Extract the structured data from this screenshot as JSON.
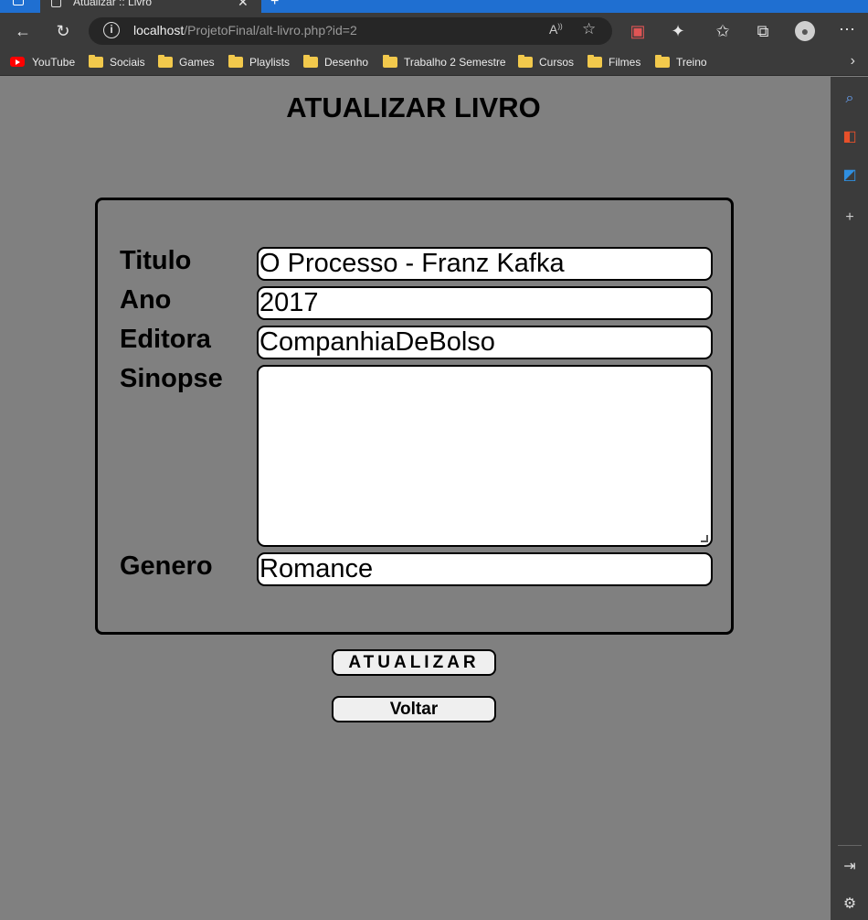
{
  "browser": {
    "tab_title": "Atualizar :: Livro",
    "url_host": "localhost",
    "url_path": "/ProjetoFinal/alt-livro.php?id=2",
    "bookmarks": [
      "YouTube",
      "Sociais",
      "Games",
      "Playlists",
      "Desenho",
      "Trabalho 2 Semestre",
      "Cursos",
      "Filmes",
      "Treino"
    ]
  },
  "page": {
    "title": "ATUALIZAR LIVRO",
    "form": {
      "titulo_label": "Titulo",
      "titulo_value": "O Processo - Franz Kafka",
      "ano_label": "Ano",
      "ano_value": "2017",
      "editora_label": "Editora",
      "editora_value": "CompanhiaDeBolso",
      "sinopse_label": "Sinopse",
      "sinopse_value": "",
      "genero_label": "Genero",
      "genero_value": "Romance"
    },
    "buttons": {
      "atualizar": "ATUALIZAR",
      "voltar": "Voltar"
    }
  },
  "colors": {
    "page_background": "#808080",
    "browser_chrome": "#3b3b3b",
    "tab_strip": "#1f6fd1"
  }
}
